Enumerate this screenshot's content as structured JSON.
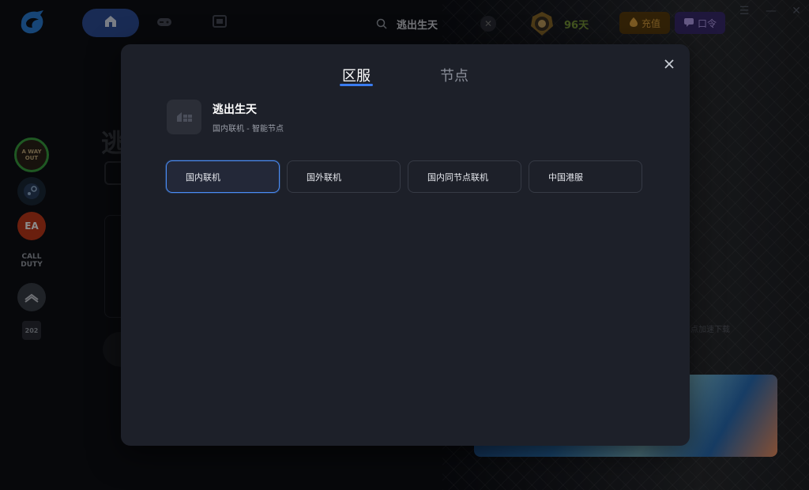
{
  "app": {
    "search_text": "逃出生天",
    "vip_days": "96天",
    "recharge_label": "充值",
    "redeem_label": "口令"
  },
  "sidebar": {
    "items": [
      {
        "name": "a-way-out",
        "label": "A WAY OUT"
      },
      {
        "name": "steam",
        "label": ""
      },
      {
        "name": "ea",
        "label": "EA"
      },
      {
        "name": "call-of-duty",
        "label": "CALL DUTY"
      },
      {
        "name": "platform",
        "label": ""
      },
      {
        "name": "year",
        "label": "202"
      }
    ]
  },
  "background": {
    "title_fragment": "逃",
    "download_text": "点加速下载"
  },
  "modal": {
    "tabs": [
      {
        "label": "区服",
        "active": true
      },
      {
        "label": "节点",
        "active": false
      }
    ],
    "game": {
      "name": "逃出生天",
      "subtitle": "国内联机 - 智能节点"
    },
    "regions": [
      {
        "label": "国内联机",
        "selected": true
      },
      {
        "label": "国外联机",
        "selected": false
      },
      {
        "label": "国内同节点联机",
        "selected": false
      },
      {
        "label": "中国港服",
        "selected": false
      }
    ]
  },
  "colors": {
    "accent": "#3a7cf0",
    "modal_bg": "#1d2029",
    "app_bg": "#0d0f15"
  }
}
